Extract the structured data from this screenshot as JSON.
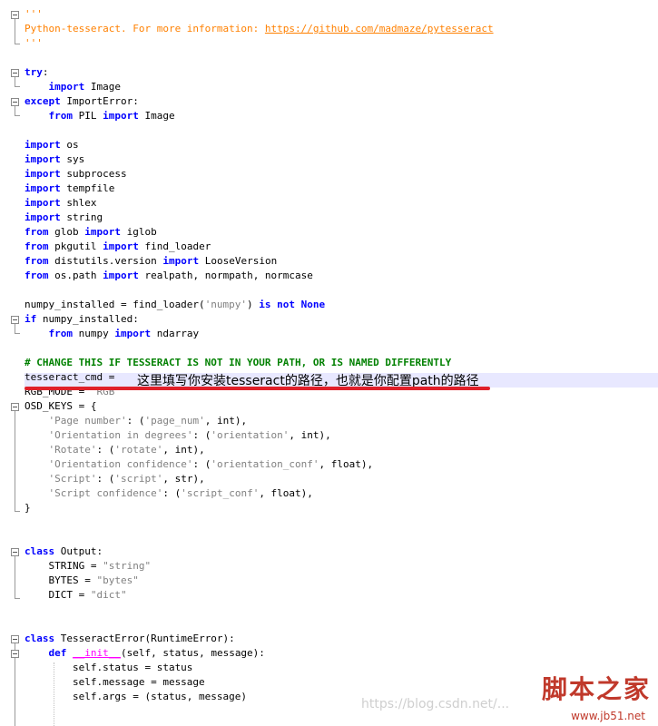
{
  "lines": [
    [
      [
        "doc",
        "'''"
      ]
    ],
    [
      [
        "doc",
        "Python-tesseract. For more information: "
      ],
      [
        "link",
        "https://github.com/madmaze/pytesseract"
      ]
    ],
    [
      [
        "doc",
        "'''"
      ]
    ],
    [],
    [
      [
        "kw",
        "try"
      ],
      [
        "plain",
        ":"
      ]
    ],
    [
      [
        "plain",
        "    "
      ],
      [
        "kw",
        "import"
      ],
      [
        "plain",
        " Image"
      ]
    ],
    [
      [
        "kw",
        "except"
      ],
      [
        "plain",
        " ImportError:"
      ]
    ],
    [
      [
        "plain",
        "    "
      ],
      [
        "kw",
        "from"
      ],
      [
        "plain",
        " PIL "
      ],
      [
        "kw",
        "import"
      ],
      [
        "plain",
        " Image"
      ]
    ],
    [],
    [
      [
        "kw",
        "import"
      ],
      [
        "plain",
        " os"
      ]
    ],
    [
      [
        "kw",
        "import"
      ],
      [
        "plain",
        " sys"
      ]
    ],
    [
      [
        "kw",
        "import"
      ],
      [
        "plain",
        " subprocess"
      ]
    ],
    [
      [
        "kw",
        "import"
      ],
      [
        "plain",
        " tempfile"
      ]
    ],
    [
      [
        "kw",
        "import"
      ],
      [
        "plain",
        " shlex"
      ]
    ],
    [
      [
        "kw",
        "import"
      ],
      [
        "plain",
        " string"
      ]
    ],
    [
      [
        "kw",
        "from"
      ],
      [
        "plain",
        " glob "
      ],
      [
        "kw",
        "import"
      ],
      [
        "plain",
        " iglob"
      ]
    ],
    [
      [
        "kw",
        "from"
      ],
      [
        "plain",
        " pkgutil "
      ],
      [
        "kw",
        "import"
      ],
      [
        "plain",
        " find_loader"
      ]
    ],
    [
      [
        "kw",
        "from"
      ],
      [
        "plain",
        " distutils.version "
      ],
      [
        "kw",
        "import"
      ],
      [
        "plain",
        " LooseVersion"
      ]
    ],
    [
      [
        "kw",
        "from"
      ],
      [
        "plain",
        " os.path "
      ],
      [
        "kw",
        "import"
      ],
      [
        "plain",
        " realpath, normpath, normcase"
      ]
    ],
    [],
    [
      [
        "plain",
        "numpy_installed = find_loader("
      ],
      [
        "str",
        "'numpy'"
      ],
      [
        "plain",
        ") "
      ],
      [
        "kw",
        "is not"
      ],
      [
        "plain",
        " "
      ],
      [
        "const",
        "None"
      ]
    ],
    [
      [
        "kw",
        "if"
      ],
      [
        "plain",
        " numpy_installed:"
      ]
    ],
    [
      [
        "plain",
        "    "
      ],
      [
        "kw",
        "from"
      ],
      [
        "plain",
        " numpy "
      ],
      [
        "kw",
        "import"
      ],
      [
        "plain",
        " ndarray"
      ]
    ],
    [],
    [
      [
        "cmt",
        "# CHANGE THIS IF TESSERACT IS NOT IN YOUR PATH, OR IS NAMED DIFFERENTLY"
      ]
    ],
    [
      [
        "plain",
        "tesseract_cmd = "
      ]
    ],
    [
      [
        "plain",
        "RGB_MODE = "
      ],
      [
        "str",
        "'RGB'"
      ]
    ],
    [
      [
        "plain",
        "OSD_KEYS = {"
      ]
    ],
    [
      [
        "plain",
        "    "
      ],
      [
        "str",
        "'Page number'"
      ],
      [
        "plain",
        ": ("
      ],
      [
        "str",
        "'page_num'"
      ],
      [
        "plain",
        ", int),"
      ]
    ],
    [
      [
        "plain",
        "    "
      ],
      [
        "str",
        "'Orientation in degrees'"
      ],
      [
        "plain",
        ": ("
      ],
      [
        "str",
        "'orientation'"
      ],
      [
        "plain",
        ", int),"
      ]
    ],
    [
      [
        "plain",
        "    "
      ],
      [
        "str",
        "'Rotate'"
      ],
      [
        "plain",
        ": ("
      ],
      [
        "str",
        "'rotate'"
      ],
      [
        "plain",
        ", int),"
      ]
    ],
    [
      [
        "plain",
        "    "
      ],
      [
        "str",
        "'Orientation confidence'"
      ],
      [
        "plain",
        ": ("
      ],
      [
        "str",
        "'orientation_conf'"
      ],
      [
        "plain",
        ", float),"
      ]
    ],
    [
      [
        "plain",
        "    "
      ],
      [
        "str",
        "'Script'"
      ],
      [
        "plain",
        ": ("
      ],
      [
        "str",
        "'script'"
      ],
      [
        "plain",
        ", str),"
      ]
    ],
    [
      [
        "plain",
        "    "
      ],
      [
        "str",
        "'Script confidence'"
      ],
      [
        "plain",
        ": ("
      ],
      [
        "str",
        "'script_conf'"
      ],
      [
        "plain",
        ", float),"
      ]
    ],
    [
      [
        "plain",
        "}"
      ]
    ],
    [],
    [],
    [
      [
        "kw",
        "class"
      ],
      [
        "plain",
        " Output:"
      ]
    ],
    [
      [
        "plain",
        "    STRING = "
      ],
      [
        "str",
        "\"string\""
      ]
    ],
    [
      [
        "plain",
        "    BYTES = "
      ],
      [
        "str",
        "\"bytes\""
      ]
    ],
    [
      [
        "plain",
        "    DICT = "
      ],
      [
        "str",
        "\"dict\""
      ]
    ],
    [],
    [],
    [
      [
        "kw",
        "class"
      ],
      [
        "plain",
        " TesseractError(RuntimeError):"
      ]
    ],
    [
      [
        "plain",
        "    "
      ],
      [
        "kw",
        "def"
      ],
      [
        "plain",
        " "
      ],
      [
        "fn",
        "__init__"
      ],
      [
        "plain",
        "(self, status, message):"
      ]
    ],
    [
      [
        "plain",
        "        self.status = status"
      ]
    ],
    [
      [
        "plain",
        "        self.message = message"
      ]
    ],
    [
      [
        "plain",
        "        self.args = (status, message)"
      ]
    ]
  ],
  "annotation": "这里填写你安装tesseract的路径，也就是你配置path的路径",
  "watermark": {
    "blog": "https://blog.csdn.net/...",
    "site_cn": "脚本之家",
    "site_url": "www.jb51.net"
  },
  "colors": {
    "keyword": "#0000ff",
    "string": "#808080",
    "docstring": "#ff8000",
    "comment": "#008000",
    "highlight_line": "#e8e8ff",
    "annotation_underline": "#e0202a"
  }
}
